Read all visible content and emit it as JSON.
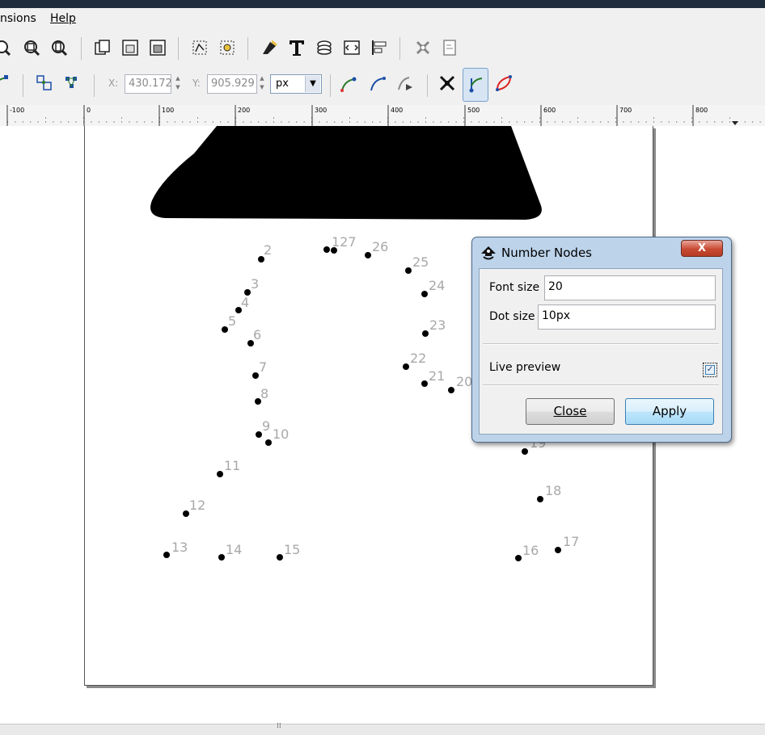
{
  "menubar": {
    "items": [
      "nsions",
      "Help"
    ]
  },
  "controls": {
    "x_label": "X:",
    "x_value": "430.172",
    "y_label": "Y:",
    "y_value": "905.929",
    "unit": "px"
  },
  "ruler": {
    "ticks": [
      "-100",
      "0",
      "100",
      "200",
      "300",
      "400",
      "500",
      "600",
      "700",
      "800"
    ]
  },
  "nodes": [
    "2",
    "3",
    "4",
    "5",
    "6",
    "7",
    "8",
    "9",
    "10",
    "11",
    "12",
    "13",
    "14",
    "15",
    "16",
    "17",
    "18",
    "19",
    "20",
    "21",
    "22",
    "23",
    "24",
    "25",
    "26",
    "127"
  ],
  "dialog": {
    "title": "Number Nodes",
    "close_glyph": "X",
    "font_size_label": "Font size",
    "font_size_value": "20",
    "dot_size_label": "Dot size",
    "dot_size_value": "10px",
    "live_preview_label": "Live preview",
    "live_preview_checked": true,
    "close_button": "Close",
    "apply_button": "Apply"
  },
  "colors": {
    "page_border": "#555555",
    "node_label": "#a8a8a8",
    "dialog_frame": "#bcd3ea",
    "apply_button": "#bee6fd"
  }
}
